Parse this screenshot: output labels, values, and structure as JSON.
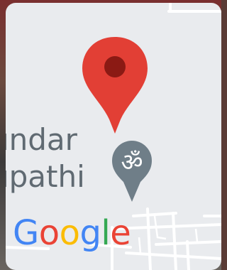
{
  "map": {
    "place_label_line1": "undar",
    "place_label_line2": "upathi",
    "poi_icon": "om-temple-icon",
    "pin_icon": "location-pin-icon",
    "pin_color": "#e23f35",
    "pin_dot_color": "#8b1a14",
    "poi_color": "#6f7e88"
  },
  "logo": {
    "letters": [
      "G",
      "o",
      "o",
      "g",
      "l",
      "e"
    ],
    "colors": [
      "#4285f4",
      "#ea4335",
      "#fbbc05",
      "#4285f4",
      "#34a853",
      "#ea4335"
    ]
  }
}
